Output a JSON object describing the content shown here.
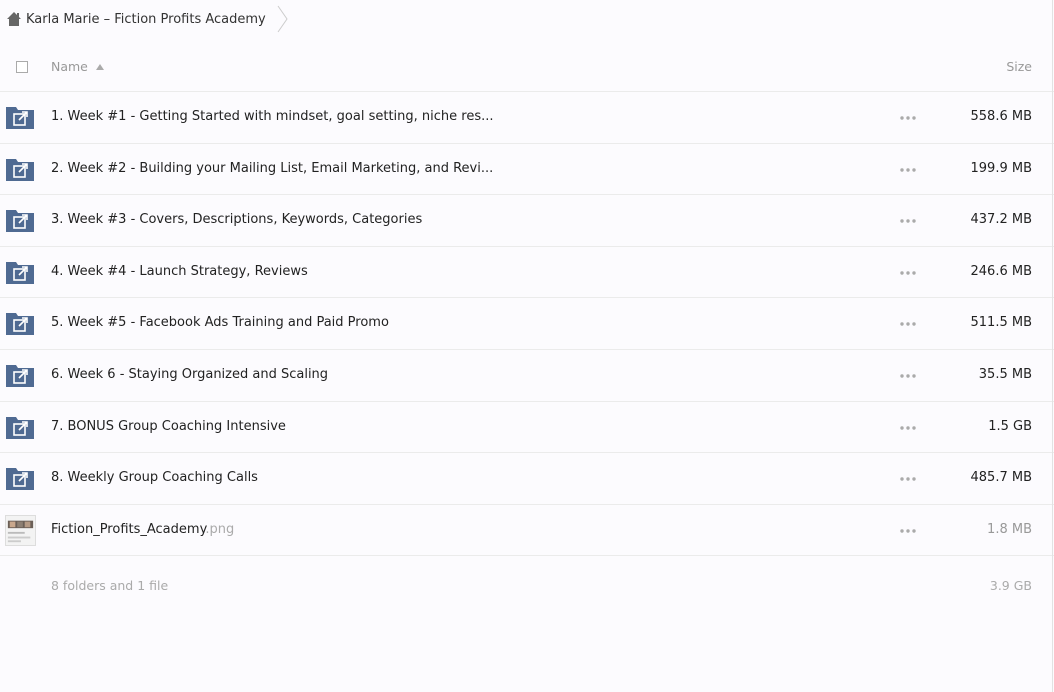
{
  "breadcrumb": {
    "icon": "home-icon",
    "title": "Karla Marie – Fiction Profits Academy"
  },
  "header": {
    "name_label": "Name",
    "size_label": "Size",
    "sort": "ascending"
  },
  "items": [
    {
      "type": "folder",
      "icon": "shared-folder-icon",
      "name": "1. Week #1 - Getting Started with mindset, goal setting, niche res...",
      "size": "558.6 MB"
    },
    {
      "type": "folder",
      "icon": "shared-folder-icon",
      "name": "2. Week #2 - Building your Mailing List, Email Marketing, and Revi...",
      "size": "199.9 MB"
    },
    {
      "type": "folder",
      "icon": "shared-folder-icon",
      "name": "3. Week #3 - Covers, Descriptions, Keywords, Categories",
      "size": "437.2 MB"
    },
    {
      "type": "folder",
      "icon": "shared-folder-icon",
      "name": "4. Week #4 - Launch Strategy, Reviews",
      "size": "246.6 MB"
    },
    {
      "type": "folder",
      "icon": "shared-folder-icon",
      "name": "5. Week #5 - Facebook Ads Training and Paid Promo",
      "size": "511.5 MB"
    },
    {
      "type": "folder",
      "icon": "shared-folder-icon",
      "name": "6. Week 6 - Staying Organized and Scaling",
      "size": "35.5 MB"
    },
    {
      "type": "folder",
      "icon": "shared-folder-icon",
      "name": "7. BONUS Group Coaching Intensive",
      "size": "1.5 GB"
    },
    {
      "type": "folder",
      "icon": "shared-folder-icon",
      "name": "8. Weekly Group Coaching Calls",
      "size": "485.7 MB"
    },
    {
      "type": "file",
      "icon": "image-thumbnail",
      "name": "Fiction_Profits_Academy",
      "ext": ".png",
      "size": "1.8 MB"
    }
  ],
  "summary": {
    "count": "8 folders and 1 file",
    "total": "3.9 GB"
  },
  "colors": {
    "folder": "#4f6a92",
    "background": "#fcfbfe",
    "divider": "#ebebeb"
  }
}
